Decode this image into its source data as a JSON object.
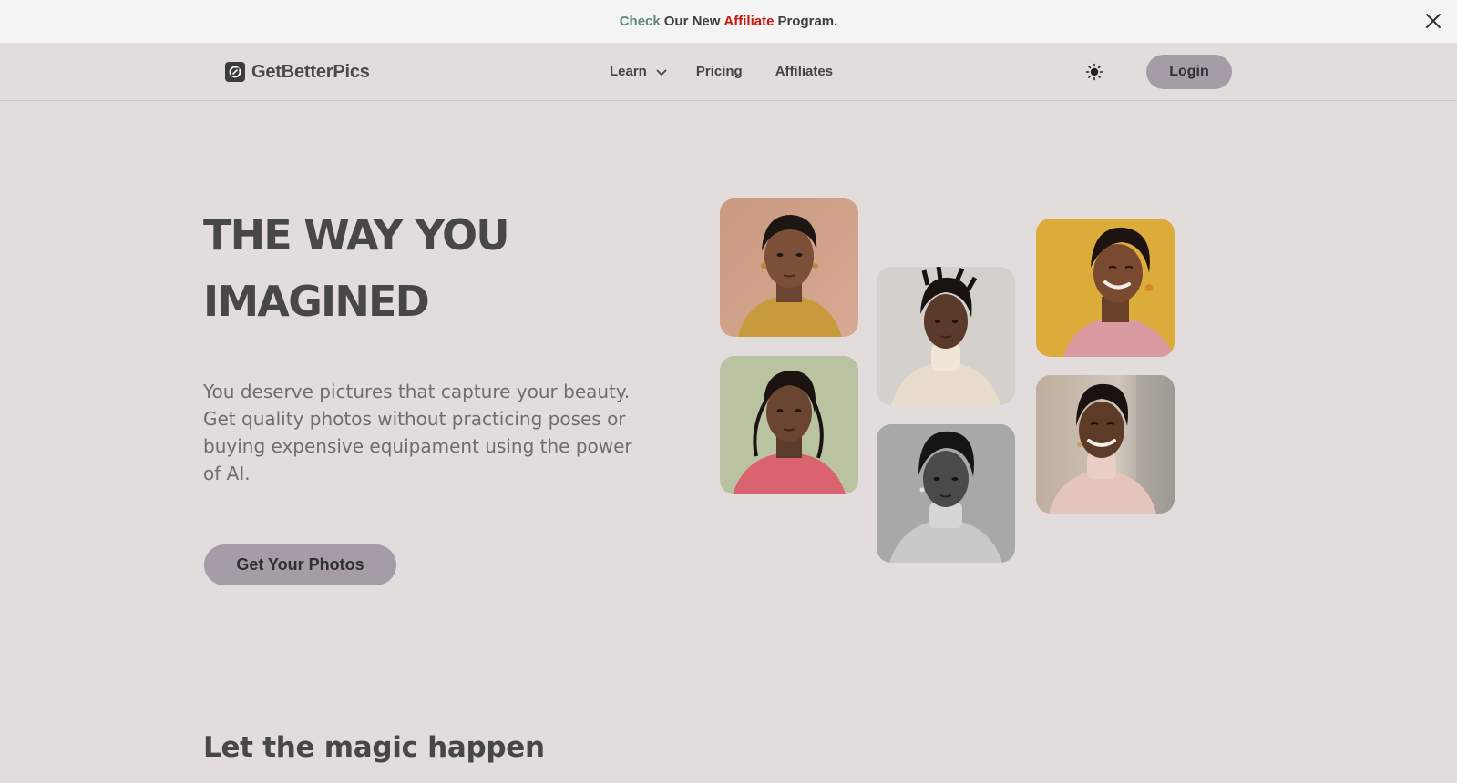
{
  "announcement": {
    "parts": [
      "Check",
      "Our New",
      "Affiliate",
      "Program."
    ],
    "colors": {
      "check": "#5f8a77",
      "affiliate": "#c8160c"
    },
    "close_icon": "close-icon"
  },
  "header": {
    "logo_text": "GetBetterPics",
    "logo_icon": "brand-logo-icon",
    "nav": {
      "learn": "Learn",
      "pricing": "Pricing",
      "affiliates": "Affiliates"
    },
    "theme_icon": "sun-icon",
    "login_label": "Login"
  },
  "hero": {
    "title_line1": "THE WAY YOU",
    "title_line2": "IMAGINED",
    "description": "You deserve pictures that capture your beauty. Get quality photos without practicing poses or buying expensive equipament using the power of AI.",
    "cta_label": "Get Your Photos"
  },
  "gallery": {
    "photos": [
      {
        "name": "portrait-peach-background"
      },
      {
        "name": "portrait-green-background"
      },
      {
        "name": "portrait-grey-background"
      },
      {
        "name": "portrait-monochrome"
      },
      {
        "name": "portrait-yellow-background"
      },
      {
        "name": "portrait-street-background"
      }
    ]
  },
  "section": {
    "title": "Let the magic happen"
  },
  "theme": {
    "page_bg": "#e3dcdd",
    "announce_bg": "#f4f4f4",
    "button_bg": "#a59ca8"
  }
}
